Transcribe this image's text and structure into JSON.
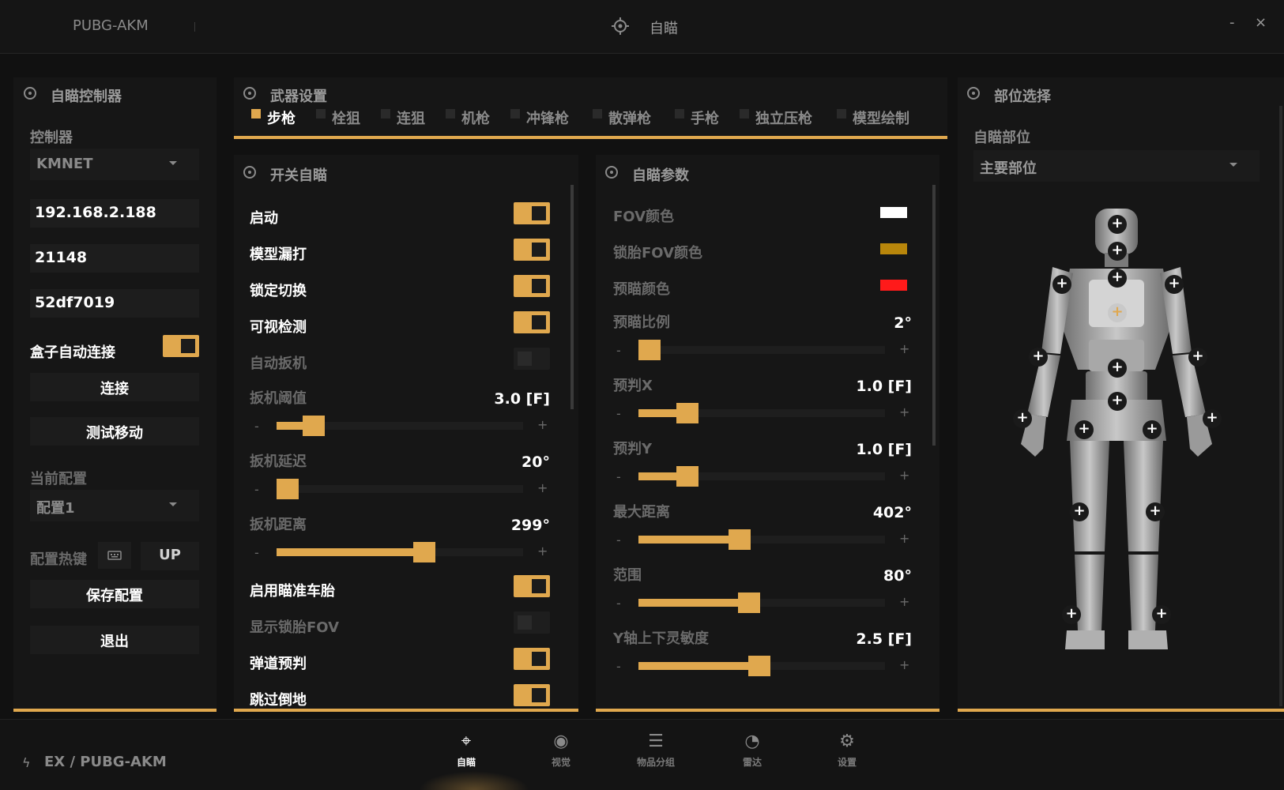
{
  "titlebar": {
    "app_title": "PUBG-AKM",
    "center_title": "自瞄",
    "minimize": "-",
    "close": "×"
  },
  "left": {
    "title": "自瞄控制器",
    "controller_label": "控制器",
    "controller_value": "KMNET",
    "ip": "192.168.2.188",
    "port": "21148",
    "uuid": "52df7019",
    "auto_connect_label": "盒子自动连接",
    "auto_connect_on": true,
    "connect_btn": "连接",
    "test_move_btn": "测试移动",
    "config_label": "当前配置",
    "config_value": "配置1",
    "hotkey_label": "配置热键",
    "hotkey_icon": "keyboard-icon",
    "hotkey_value": "UP",
    "save_btn": "保存配置",
    "exit_btn": "退出"
  },
  "weapons": {
    "title": "武器设置",
    "tabs": [
      {
        "label": "步枪",
        "active": true
      },
      {
        "label": "栓狙",
        "active": false
      },
      {
        "label": "连狙",
        "active": false
      },
      {
        "label": "机枪",
        "active": false
      },
      {
        "label": "冲锋枪",
        "active": false
      },
      {
        "label": "散弹枪",
        "active": false
      },
      {
        "label": "手枪",
        "active": false
      },
      {
        "label": "独立压枪",
        "active": false
      },
      {
        "label": "模型绘制",
        "active": false
      }
    ]
  },
  "switches": {
    "title": "开关自瞄",
    "items": [
      {
        "label": "启动",
        "on": true
      },
      {
        "label": "模型漏打",
        "on": true
      },
      {
        "label": "锁定切换",
        "on": true
      },
      {
        "label": "可视检测",
        "on": true
      },
      {
        "label": "自动扳机",
        "on": false
      }
    ],
    "sliders": [
      {
        "label": "扳机阈值",
        "value": "3.0 [F]",
        "fraction": 0.15
      },
      {
        "label": "扳机延迟",
        "value": "20°",
        "fraction": 0.03
      },
      {
        "label": "扳机距离",
        "value": "299°",
        "fraction": 0.6
      }
    ],
    "items2": [
      {
        "label": "启用瞄准车胎",
        "on": true
      },
      {
        "label": "显示锁胎FOV",
        "on": false
      },
      {
        "label": "弹道预判",
        "on": true
      },
      {
        "label": "跳过倒地",
        "on": true
      }
    ],
    "minus": "-",
    "plus": "+"
  },
  "params": {
    "title": "自瞄参数",
    "colors": [
      {
        "label": "FOV颜色",
        "color": "#ffffff"
      },
      {
        "label": "锁胎FOV颜色",
        "color": "#b8860b"
      },
      {
        "label": "预瞄颜色",
        "color": "#ff1a1a"
      }
    ],
    "sliders": [
      {
        "label": "预瞄比例",
        "value": "2°",
        "fraction": 0.04
      },
      {
        "label": "预判X",
        "value": "1.0 [F]",
        "fraction": 0.2
      },
      {
        "label": "预判Y",
        "value": "1.0 [F]",
        "fraction": 0.2
      },
      {
        "label": "最大距离",
        "value": "402°",
        "fraction": 0.41
      },
      {
        "label": "范围",
        "value": "80°",
        "fraction": 0.45
      },
      {
        "label": "Y轴上下灵敏度",
        "value": "2.5 [F]",
        "fraction": 0.49
      }
    ]
  },
  "bodypart": {
    "title": "部位选择",
    "label": "自瞄部位",
    "value": "主要部位"
  },
  "footer": {
    "path": "EX / PUBG-AKM",
    "nav": [
      {
        "label": "自瞄",
        "icon": "crosshair-icon",
        "glyph": "⌖",
        "active": true
      },
      {
        "label": "视觉",
        "icon": "eye-icon",
        "glyph": "◉",
        "active": false
      },
      {
        "label": "物品分组",
        "icon": "sliders-icon",
        "glyph": "☰",
        "active": false
      },
      {
        "label": "雷达",
        "icon": "radar-icon",
        "glyph": "◔",
        "active": false
      },
      {
        "label": "设置",
        "icon": "gear-icon",
        "glyph": "⚙",
        "active": false
      }
    ]
  },
  "colors": {
    "accent": "#e0a84e",
    "bg": "#111111",
    "panel": "#161616"
  }
}
